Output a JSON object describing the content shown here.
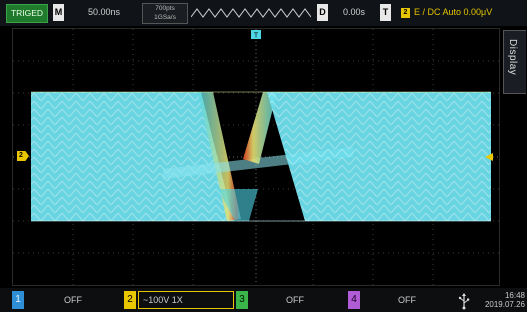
{
  "topbar": {
    "trig_status": "TRIGED",
    "m_label": "M",
    "timebase": "50.00ns",
    "memory_depth": "700pts",
    "sample_rate": "1GSa/s",
    "d_label": "D",
    "delay": "0.00s",
    "t_label": "T",
    "trigger_channel": "2",
    "trigger_info": "E / DC Auto 0.00μV"
  },
  "side_menu": {
    "display_label": "Display"
  },
  "markers": {
    "ch2_marker": "2"
  },
  "channels": [
    {
      "num": "1",
      "status": "OFF",
      "color": "#2e8fd6"
    },
    {
      "num": "2",
      "status": "~100V 1X",
      "color": "#e8c700"
    },
    {
      "num": "3",
      "status": "OFF",
      "color": "#3ab54a"
    },
    {
      "num": "4",
      "status": "OFF",
      "color": "#b05cd6"
    }
  ],
  "clock": {
    "time": "16:48",
    "date": "2019.07.26"
  },
  "colors": {
    "trace": "#4fd6e6",
    "accent": "#e8c700"
  }
}
